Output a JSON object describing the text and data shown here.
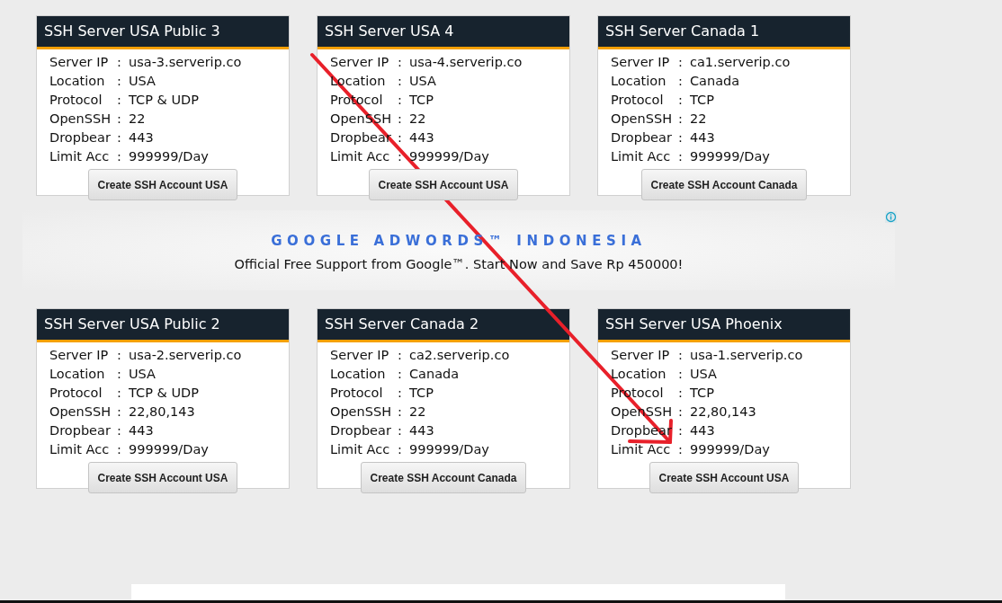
{
  "servers_top": [
    {
      "title": "SSH Server USA Public 3",
      "fields": [
        {
          "label": "Server IP",
          "separator": ":",
          "value": "usa-3.serverip.co"
        },
        {
          "label": "Location",
          "separator": ":",
          "value": "USA"
        },
        {
          "label": "Protocol",
          "separator": ":",
          "value": "TCP & UDP"
        },
        {
          "label": "OpenSSH",
          "separator": ":",
          "value": "22"
        },
        {
          "label": "Dropbear",
          "separator": ":",
          "value": "443"
        },
        {
          "label": "Limit Acc",
          "separator": ":",
          "value": "999999/Day"
        }
      ],
      "button": "Create SSH Account USA"
    },
    {
      "title": "SSH Server USA 4",
      "fields": [
        {
          "label": "Server IP",
          "separator": ":",
          "value": "usa-4.serverip.co"
        },
        {
          "label": "Location",
          "separator": ":",
          "value": "USA"
        },
        {
          "label": "Protocol",
          "separator": ":",
          "value": "TCP"
        },
        {
          "label": "OpenSSH",
          "separator": ":",
          "value": "22"
        },
        {
          "label": "Dropbear",
          "separator": ":",
          "value": "443"
        },
        {
          "label": "Limit Acc",
          "separator": ":",
          "value": "999999/Day"
        }
      ],
      "button": "Create SSH Account USA"
    },
    {
      "title": "SSH Server Canada 1",
      "fields": [
        {
          "label": "Server IP",
          "separator": ":",
          "value": "ca1.serverip.co"
        },
        {
          "label": "Location",
          "separator": ":",
          "value": "Canada"
        },
        {
          "label": "Protocol",
          "separator": ":",
          "value": "TCP"
        },
        {
          "label": "OpenSSH",
          "separator": ":",
          "value": "22"
        },
        {
          "label": "Dropbear",
          "separator": ":",
          "value": "443"
        },
        {
          "label": "Limit Acc",
          "separator": ":",
          "value": "999999/Day"
        }
      ],
      "button": "Create SSH Account Canada"
    }
  ],
  "ad": {
    "title": "GOOGLE ADWORDS™ INDONESIA",
    "text": "Official Free Support from Google™. Start Now and Save Rp 450000!"
  },
  "servers_bottom": [
    {
      "title": "SSH Server USA Public 2",
      "fields": [
        {
          "label": "Server IP",
          "separator": ":",
          "value": "usa-2.serverip.co"
        },
        {
          "label": "Location",
          "separator": ":",
          "value": "USA"
        },
        {
          "label": "Protocol",
          "separator": ":",
          "value": "TCP & UDP"
        },
        {
          "label": "OpenSSH",
          "separator": ":",
          "value": "22,80,143"
        },
        {
          "label": "Dropbear",
          "separator": ":",
          "value": "443"
        },
        {
          "label": "Limit Acc",
          "separator": ":",
          "value": "999999/Day"
        }
      ],
      "button": "Create SSH Account USA"
    },
    {
      "title": "SSH Server Canada 2",
      "fields": [
        {
          "label": "Server IP",
          "separator": ":",
          "value": "ca2.serverip.co"
        },
        {
          "label": "Location",
          "separator": ":",
          "value": "Canada"
        },
        {
          "label": "Protocol",
          "separator": ":",
          "value": "TCP"
        },
        {
          "label": "OpenSSH",
          "separator": ":",
          "value": "22"
        },
        {
          "label": "Dropbear",
          "separator": ":",
          "value": "443"
        },
        {
          "label": "Limit Acc",
          "separator": ":",
          "value": "999999/Day"
        }
      ],
      "button": "Create SSH Account Canada"
    },
    {
      "title": "SSH Server USA Phoenix",
      "fields": [
        {
          "label": "Server IP",
          "separator": ":",
          "value": "usa-1.serverip.co"
        },
        {
          "label": "Location",
          "separator": ":",
          "value": "USA"
        },
        {
          "label": "Protocol",
          "separator": ":",
          "value": "TCP"
        },
        {
          "label": "OpenSSH",
          "separator": ":",
          "value": "22,80,143"
        },
        {
          "label": "Dropbear",
          "separator": ":",
          "value": "443"
        },
        {
          "label": "Limit Acc",
          "separator": ":",
          "value": "999999/Day"
        }
      ],
      "button": "Create SSH Account USA"
    }
  ]
}
